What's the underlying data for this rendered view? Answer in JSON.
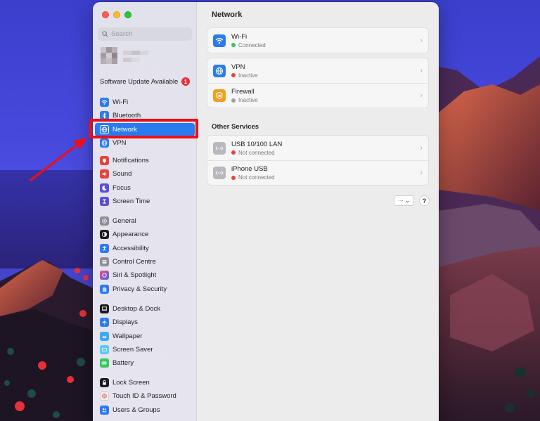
{
  "window": {
    "page_title": "Network",
    "search": {
      "placeholder": "Search"
    }
  },
  "sidebar": {
    "update_label": "Software Update Available",
    "update_count": "1",
    "groups": [
      [
        {
          "label": "Wi-Fi",
          "icon": "wifi-icon",
          "color": "#2b7bf0"
        },
        {
          "label": "Bluetooth",
          "icon": "bluetooth-icon",
          "color": "#2b7bf0"
        },
        {
          "label": "Network",
          "icon": "globe-icon",
          "color": "#2b7bf0",
          "selected": true
        },
        {
          "label": "VPN",
          "icon": "vpn-globe-icon",
          "color": "#2b7bf0"
        }
      ],
      [
        {
          "label": "Notifications",
          "icon": "bell-icon",
          "color": "#e8423a"
        },
        {
          "label": "Sound",
          "icon": "speaker-icon",
          "color": "#e8423a"
        },
        {
          "label": "Focus",
          "icon": "moon-icon",
          "color": "#5b4fd8"
        },
        {
          "label": "Screen Time",
          "icon": "hourglass-icon",
          "color": "#5b4fd8"
        }
      ],
      [
        {
          "label": "General",
          "icon": "gear-icon",
          "color": "#8e8e93"
        },
        {
          "label": "Appearance",
          "icon": "appearance-icon",
          "color": "#1c1c1e"
        },
        {
          "label": "Accessibility",
          "icon": "accessibility-icon",
          "color": "#2b7bf0"
        },
        {
          "label": "Control Centre",
          "icon": "control-centre-icon",
          "color": "#8e8e93"
        },
        {
          "label": "Siri & Spotlight",
          "icon": "siri-icon",
          "color": "#3a2a6b"
        },
        {
          "label": "Privacy & Security",
          "icon": "hand-icon",
          "color": "#2b7bf0"
        }
      ],
      [
        {
          "label": "Desktop & Dock",
          "icon": "dock-icon",
          "color": "#1c1c1e"
        },
        {
          "label": "Displays",
          "icon": "sun-icon",
          "color": "#2b7bf0"
        },
        {
          "label": "Wallpaper",
          "icon": "wallpaper-icon",
          "color": "#3fa9f5"
        },
        {
          "label": "Screen Saver",
          "icon": "screen-saver-icon",
          "color": "#5ac8fa"
        },
        {
          "label": "Battery",
          "icon": "battery-icon",
          "color": "#34c759"
        }
      ],
      [
        {
          "label": "Lock Screen",
          "icon": "lock-icon",
          "color": "#1c1c1e"
        },
        {
          "label": "Touch ID & Password",
          "icon": "fingerprint-icon",
          "color": "#f2f2f2"
        },
        {
          "label": "Users & Groups",
          "icon": "users-icon",
          "color": "#2b7bf0"
        }
      ]
    ]
  },
  "content": {
    "services": [
      {
        "name": "Wi-Fi",
        "status": "Connected",
        "status_color": "#34c759",
        "icon": "wifi-icon",
        "icon_color": "#2b7bf0"
      },
      {
        "name": "VPN",
        "status": "Inactive",
        "status_color": "#e8423a",
        "icon": "vpn-globe-icon",
        "icon_color": "#2b7bf0"
      },
      {
        "name": "Firewall",
        "status": "Inactive",
        "status_color": "#a0a0a0",
        "icon": "shield-icon",
        "icon_color": "#f2a01e"
      }
    ],
    "other_services_label": "Other Services",
    "other_services": [
      {
        "name": "USB 10/100 LAN",
        "status": "Not connected",
        "status_color": "#e8423a",
        "icon": "ethernet-icon",
        "icon_color": "#b8b8be"
      },
      {
        "name": "iPhone USB",
        "status": "Not connected",
        "status_color": "#e8423a",
        "icon": "ethernet-icon",
        "icon_color": "#b8b8be"
      }
    ],
    "more_button_label": "··· ⌄",
    "help_button_label": "?"
  },
  "annotation": {
    "highlight_color": "#ee0e16"
  }
}
